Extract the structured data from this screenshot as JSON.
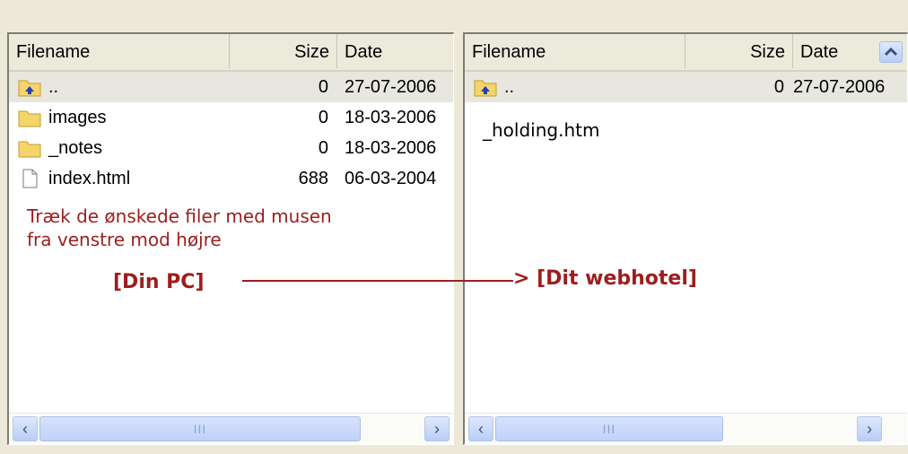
{
  "left": {
    "headers": {
      "filename": "Filename",
      "size": "Size",
      "date": "Date"
    },
    "rows": [
      {
        "icon": "parent-folder-icon",
        "name": "..",
        "size": "0",
        "date": "27-07-2006"
      },
      {
        "icon": "folder-icon",
        "name": "images",
        "size": "0",
        "date": "18-03-2006"
      },
      {
        "icon": "folder-icon",
        "name": "_notes",
        "size": "0",
        "date": "18-03-2006"
      },
      {
        "icon": "file-icon",
        "name": "index.html",
        "size": "688",
        "date": "06-03-2004"
      }
    ],
    "hint_line1": "Træk de ønskede filer med musen",
    "hint_line2": "fra venstre mod højre",
    "tag": "[Din PC]",
    "scroll_grip": "III"
  },
  "right": {
    "headers": {
      "filename": "Filename",
      "size": "Size",
      "date": "Date"
    },
    "rows": [
      {
        "icon": "parent-folder-icon",
        "name": "..",
        "size": "0",
        "date": "27-07-2006"
      }
    ],
    "overlay_item": "_holding.htm",
    "tag": "> [Dit webhotel]",
    "scroll_grip": "III"
  },
  "colors": {
    "accent": "#9d1e1e",
    "scroll": "#b9cdf5"
  }
}
